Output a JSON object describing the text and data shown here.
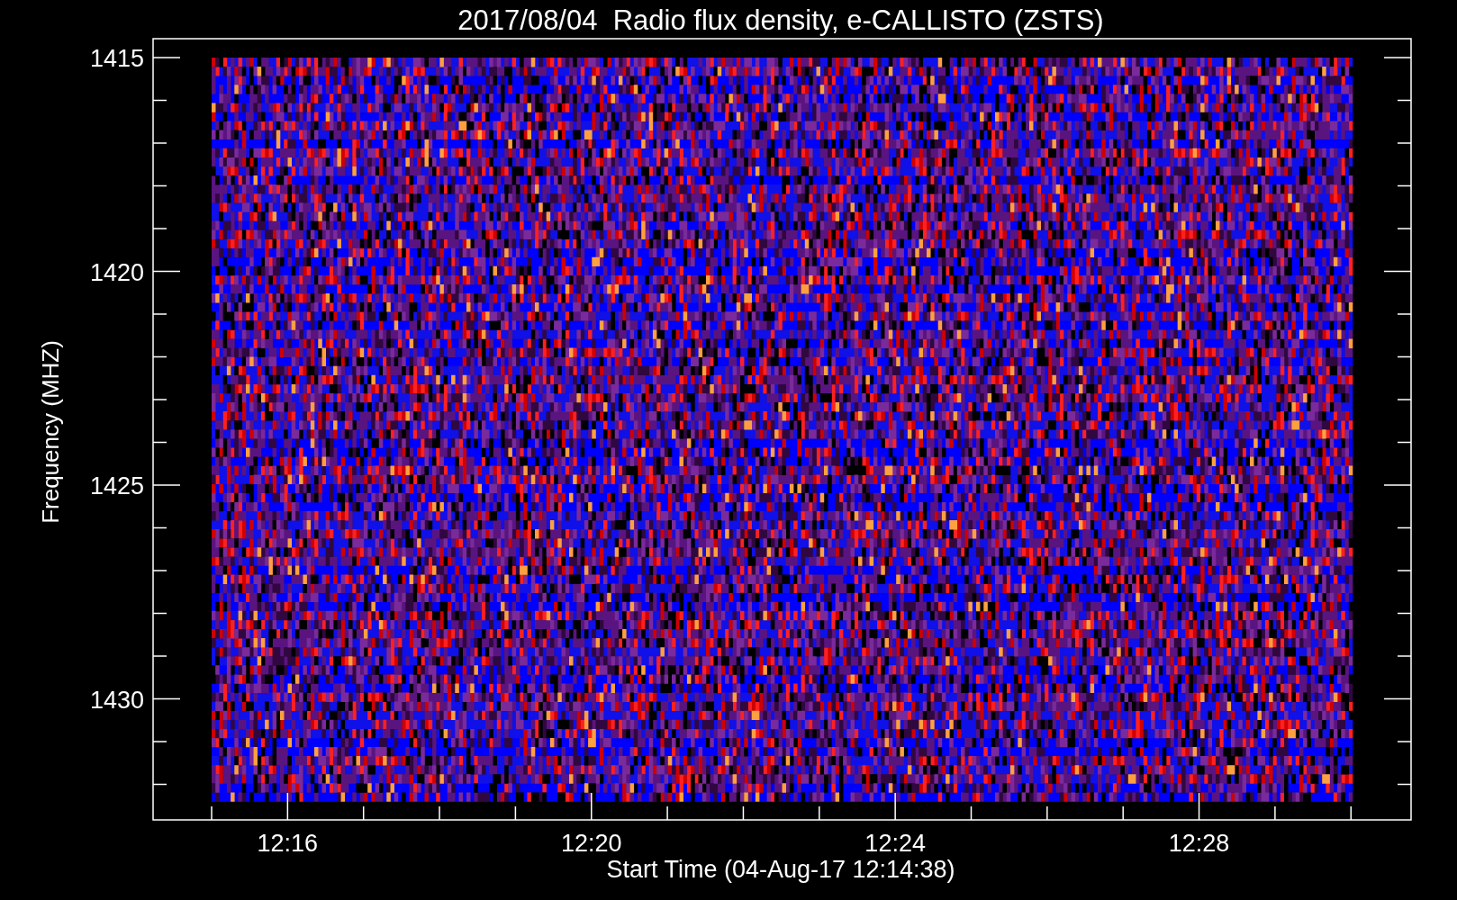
{
  "title": "2017/08/04  Radio flux density, e-CALLISTO (ZSTS)",
  "y_axis": {
    "label": "Frequency (MHZ)",
    "ticks": [
      "1415",
      "1420",
      "1425",
      "1430"
    ]
  },
  "x_axis": {
    "label": "Start Time (04-Aug-17 12:14:38)",
    "ticks": [
      "12:16",
      "12:20",
      "12:24",
      "12:28"
    ]
  }
}
